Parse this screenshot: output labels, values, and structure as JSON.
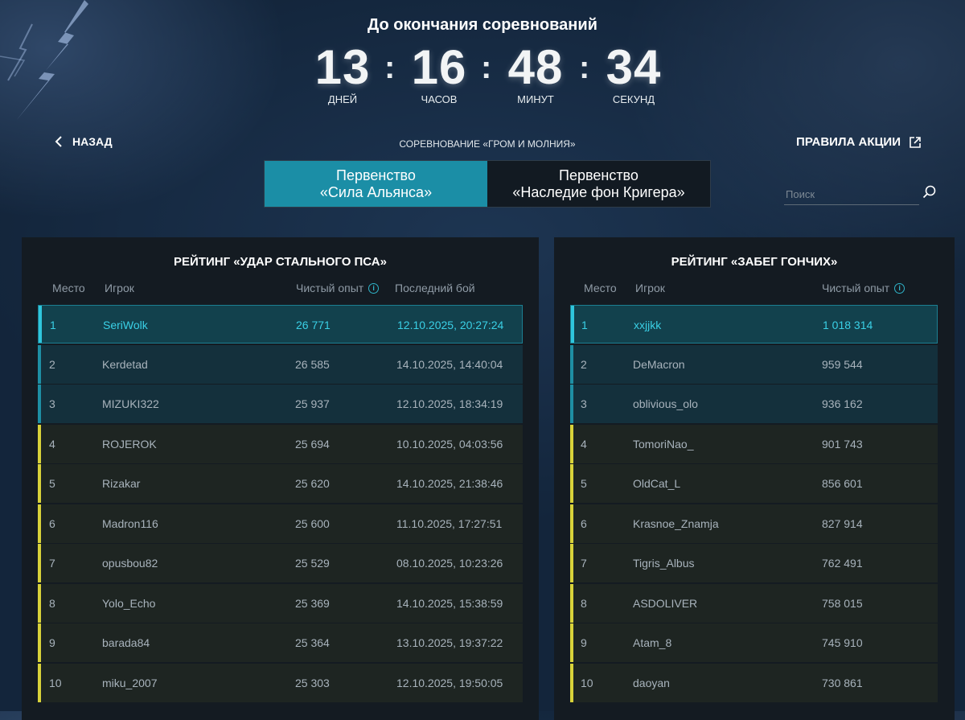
{
  "timer": {
    "title": "До окончания соревнований",
    "days": "13",
    "days_label": "ДНЕЙ",
    "hours": "16",
    "hours_label": "ЧАСОВ",
    "minutes": "48",
    "minutes_label": "МИНУТ",
    "seconds": "34",
    "seconds_label": "СЕКУНД",
    "separator": ":"
  },
  "nav": {
    "back_label": "НАЗАД",
    "competition_title": "СОРЕВНОВАНИЕ «ГРОМ И МОЛНИЯ»",
    "rules_label": "ПРАВИЛА АКЦИИ"
  },
  "tabs": [
    {
      "line1": "Первенство",
      "line2": "«Сила Альянса»",
      "active": true
    },
    {
      "line1": "Первенство",
      "line2": "«Наследие фон Кригера»",
      "active": false
    }
  ],
  "search": {
    "placeholder": "Поиск"
  },
  "left_table": {
    "title": "РЕЙТИНГ «УДАР СТАЛЬНОГО ПСА»",
    "headers": {
      "place": "Место",
      "player": "Игрок",
      "xp": "Чистый опыт",
      "last_battle": "Последний бой"
    },
    "rows": [
      {
        "place": "1",
        "player": "SeriWolk",
        "xp": "26 771",
        "last": "12.10.2025, 20:27:24"
      },
      {
        "place": "2",
        "player": "Kerdetad",
        "xp": "26 585",
        "last": "14.10.2025, 14:40:04"
      },
      {
        "place": "3",
        "player": "MIZUKI322",
        "xp": "25 937",
        "last": "12.10.2025, 18:34:19"
      },
      {
        "place": "4",
        "player": "ROJEROK",
        "xp": "25 694",
        "last": "10.10.2025, 04:03:56"
      },
      {
        "place": "5",
        "player": "Rizakar",
        "xp": "25 620",
        "last": "14.10.2025, 21:38:46"
      },
      {
        "place": "6",
        "player": "Madron116",
        "xp": "25 600",
        "last": "11.10.2025, 17:27:51"
      },
      {
        "place": "7",
        "player": "opusbou82",
        "xp": "25 529",
        "last": "08.10.2025, 10:23:26"
      },
      {
        "place": "8",
        "player": "Yolo_Echo",
        "xp": "25 369",
        "last": "14.10.2025, 15:38:59"
      },
      {
        "place": "9",
        "player": "barada84",
        "xp": "25 364",
        "last": "13.10.2025, 19:37:22"
      },
      {
        "place": "10",
        "player": "miku_2007",
        "xp": "25 303",
        "last": "12.10.2025, 19:50:05"
      }
    ]
  },
  "right_table": {
    "title": "РЕЙТИНГ «ЗАБЕГ ГОНЧИХ»",
    "headers": {
      "place": "Место",
      "player": "Игрок",
      "xp": "Чистый опыт"
    },
    "rows": [
      {
        "place": "1",
        "player": "xxjjkk",
        "xp": "1 018 314"
      },
      {
        "place": "2",
        "player": "DeMacron",
        "xp": "959 544"
      },
      {
        "place": "3",
        "player": "oblivious_olo",
        "xp": "936 162"
      },
      {
        "place": "4",
        "player": "TomoriNao_",
        "xp": "901 743"
      },
      {
        "place": "5",
        "player": "OldCat_L",
        "xp": "856 601"
      },
      {
        "place": "6",
        "player": "Krasnoe_Znamja",
        "xp": "827 914"
      },
      {
        "place": "7",
        "player": "Tigris_Albus",
        "xp": "762 491"
      },
      {
        "place": "8",
        "player": "ASDOLIVER",
        "xp": "758 015"
      },
      {
        "place": "9",
        "player": "Atam_8",
        "xp": "745 910"
      },
      {
        "place": "10",
        "player": "daoyan",
        "xp": "730 861"
      }
    ]
  },
  "icons": {
    "back": "chevron-left-icon",
    "rules": "external-link-icon",
    "search": "search-icon",
    "info": "info-icon"
  },
  "colors": {
    "accent": "#1b8ea6",
    "top3_bar": "#1e8fa4",
    "top10_bar": "#d8d23a",
    "first_text": "#3ad0e6"
  }
}
